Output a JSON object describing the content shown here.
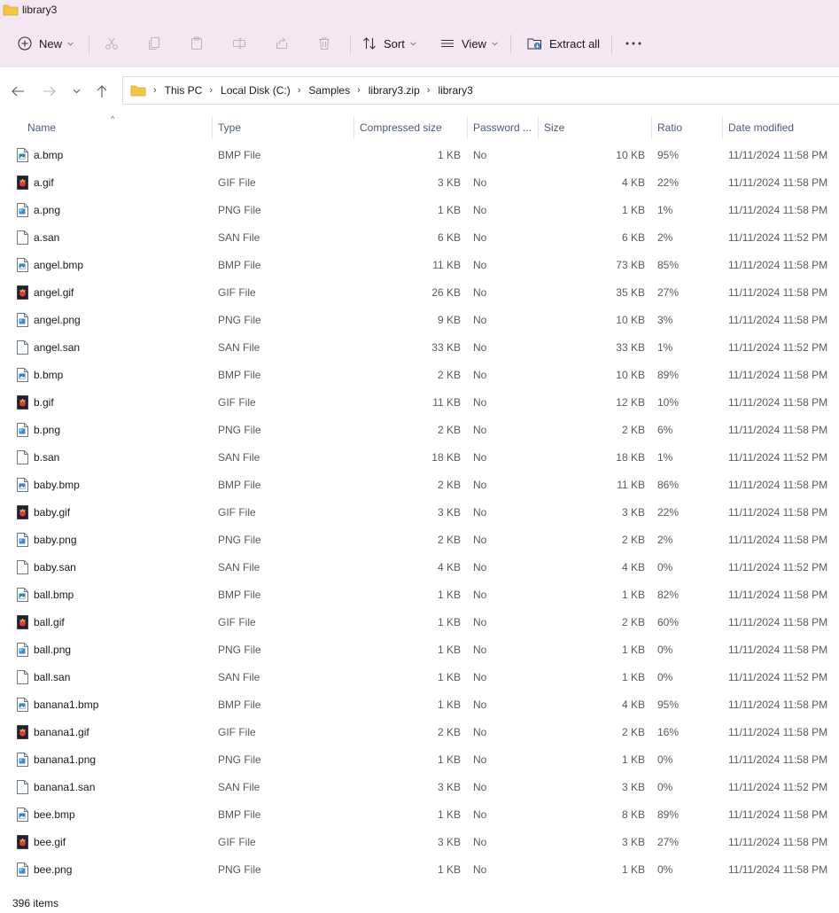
{
  "window": {
    "title": "library3"
  },
  "toolbar": {
    "new_label": "New",
    "sort_label": "Sort",
    "view_label": "View",
    "extract_label": "Extract all"
  },
  "address": {
    "crumbs": [
      "This PC",
      "Local Disk (C:)",
      "Samples",
      "library3.zip",
      "library3"
    ]
  },
  "columns": {
    "name": "Name",
    "type": "Type",
    "compressed": "Compressed size",
    "password": "Password ...",
    "size": "Size",
    "ratio": "Ratio",
    "date": "Date modified"
  },
  "files": [
    {
      "name": "a.bmp",
      "type": "BMP File",
      "compressed": "1 KB",
      "password": "No",
      "size": "10 KB",
      "ratio": "95%",
      "date": "11/11/2024 11:58 PM",
      "icon": "bmp"
    },
    {
      "name": "a.gif",
      "type": "GIF File",
      "compressed": "3 KB",
      "password": "No",
      "size": "4 KB",
      "ratio": "22%",
      "date": "11/11/2024 11:58 PM",
      "icon": "gif"
    },
    {
      "name": "a.png",
      "type": "PNG File",
      "compressed": "1 KB",
      "password": "No",
      "size": "1 KB",
      "ratio": "1%",
      "date": "11/11/2024 11:58 PM",
      "icon": "png"
    },
    {
      "name": "a.san",
      "type": "SAN File",
      "compressed": "6 KB",
      "password": "No",
      "size": "6 KB",
      "ratio": "2%",
      "date": "11/11/2024 11:52 PM",
      "icon": "blank"
    },
    {
      "name": "angel.bmp",
      "type": "BMP File",
      "compressed": "11 KB",
      "password": "No",
      "size": "73 KB",
      "ratio": "85%",
      "date": "11/11/2024 11:58 PM",
      "icon": "bmp"
    },
    {
      "name": "angel.gif",
      "type": "GIF File",
      "compressed": "26 KB",
      "password": "No",
      "size": "35 KB",
      "ratio": "27%",
      "date": "11/11/2024 11:58 PM",
      "icon": "gif"
    },
    {
      "name": "angel.png",
      "type": "PNG File",
      "compressed": "9 KB",
      "password": "No",
      "size": "10 KB",
      "ratio": "3%",
      "date": "11/11/2024 11:58 PM",
      "icon": "png"
    },
    {
      "name": "angel.san",
      "type": "SAN File",
      "compressed": "33 KB",
      "password": "No",
      "size": "33 KB",
      "ratio": "1%",
      "date": "11/11/2024 11:52 PM",
      "icon": "blank"
    },
    {
      "name": "b.bmp",
      "type": "BMP File",
      "compressed": "2 KB",
      "password": "No",
      "size": "10 KB",
      "ratio": "89%",
      "date": "11/11/2024 11:58 PM",
      "icon": "bmp"
    },
    {
      "name": "b.gif",
      "type": "GIF File",
      "compressed": "11 KB",
      "password": "No",
      "size": "12 KB",
      "ratio": "10%",
      "date": "11/11/2024 11:58 PM",
      "icon": "gif"
    },
    {
      "name": "b.png",
      "type": "PNG File",
      "compressed": "2 KB",
      "password": "No",
      "size": "2 KB",
      "ratio": "6%",
      "date": "11/11/2024 11:58 PM",
      "icon": "png"
    },
    {
      "name": "b.san",
      "type": "SAN File",
      "compressed": "18 KB",
      "password": "No",
      "size": "18 KB",
      "ratio": "1%",
      "date": "11/11/2024 11:52 PM",
      "icon": "blank"
    },
    {
      "name": "baby.bmp",
      "type": "BMP File",
      "compressed": "2 KB",
      "password": "No",
      "size": "11 KB",
      "ratio": "86%",
      "date": "11/11/2024 11:58 PM",
      "icon": "bmp"
    },
    {
      "name": "baby.gif",
      "type": "GIF File",
      "compressed": "3 KB",
      "password": "No",
      "size": "3 KB",
      "ratio": "22%",
      "date": "11/11/2024 11:58 PM",
      "icon": "gif"
    },
    {
      "name": "baby.png",
      "type": "PNG File",
      "compressed": "2 KB",
      "password": "No",
      "size": "2 KB",
      "ratio": "2%",
      "date": "11/11/2024 11:58 PM",
      "icon": "png"
    },
    {
      "name": "baby.san",
      "type": "SAN File",
      "compressed": "4 KB",
      "password": "No",
      "size": "4 KB",
      "ratio": "0%",
      "date": "11/11/2024 11:52 PM",
      "icon": "blank"
    },
    {
      "name": "ball.bmp",
      "type": "BMP File",
      "compressed": "1 KB",
      "password": "No",
      "size": "1 KB",
      "ratio": "82%",
      "date": "11/11/2024 11:58 PM",
      "icon": "bmp"
    },
    {
      "name": "ball.gif",
      "type": "GIF File",
      "compressed": "1 KB",
      "password": "No",
      "size": "2 KB",
      "ratio": "60%",
      "date": "11/11/2024 11:58 PM",
      "icon": "gif"
    },
    {
      "name": "ball.png",
      "type": "PNG File",
      "compressed": "1 KB",
      "password": "No",
      "size": "1 KB",
      "ratio": "0%",
      "date": "11/11/2024 11:58 PM",
      "icon": "png"
    },
    {
      "name": "ball.san",
      "type": "SAN File",
      "compressed": "1 KB",
      "password": "No",
      "size": "1 KB",
      "ratio": "0%",
      "date": "11/11/2024 11:52 PM",
      "icon": "blank"
    },
    {
      "name": "banana1.bmp",
      "type": "BMP File",
      "compressed": "1 KB",
      "password": "No",
      "size": "4 KB",
      "ratio": "95%",
      "date": "11/11/2024 11:58 PM",
      "icon": "bmp"
    },
    {
      "name": "banana1.gif",
      "type": "GIF File",
      "compressed": "2 KB",
      "password": "No",
      "size": "2 KB",
      "ratio": "16%",
      "date": "11/11/2024 11:58 PM",
      "icon": "gif"
    },
    {
      "name": "banana1.png",
      "type": "PNG File",
      "compressed": "1 KB",
      "password": "No",
      "size": "1 KB",
      "ratio": "0%",
      "date": "11/11/2024 11:58 PM",
      "icon": "png"
    },
    {
      "name": "banana1.san",
      "type": "SAN File",
      "compressed": "3 KB",
      "password": "No",
      "size": "3 KB",
      "ratio": "0%",
      "date": "11/11/2024 11:52 PM",
      "icon": "blank"
    },
    {
      "name": "bee.bmp",
      "type": "BMP File",
      "compressed": "1 KB",
      "password": "No",
      "size": "8 KB",
      "ratio": "89%",
      "date": "11/11/2024 11:58 PM",
      "icon": "bmp"
    },
    {
      "name": "bee.gif",
      "type": "GIF File",
      "compressed": "3 KB",
      "password": "No",
      "size": "3 KB",
      "ratio": "27%",
      "date": "11/11/2024 11:58 PM",
      "icon": "gif"
    },
    {
      "name": "bee.png",
      "type": "PNG File",
      "compressed": "1 KB",
      "password": "No",
      "size": "1 KB",
      "ratio": "0%",
      "date": "11/11/2024 11:58 PM",
      "icon": "png"
    }
  ],
  "status": {
    "item_count": "396 items"
  }
}
